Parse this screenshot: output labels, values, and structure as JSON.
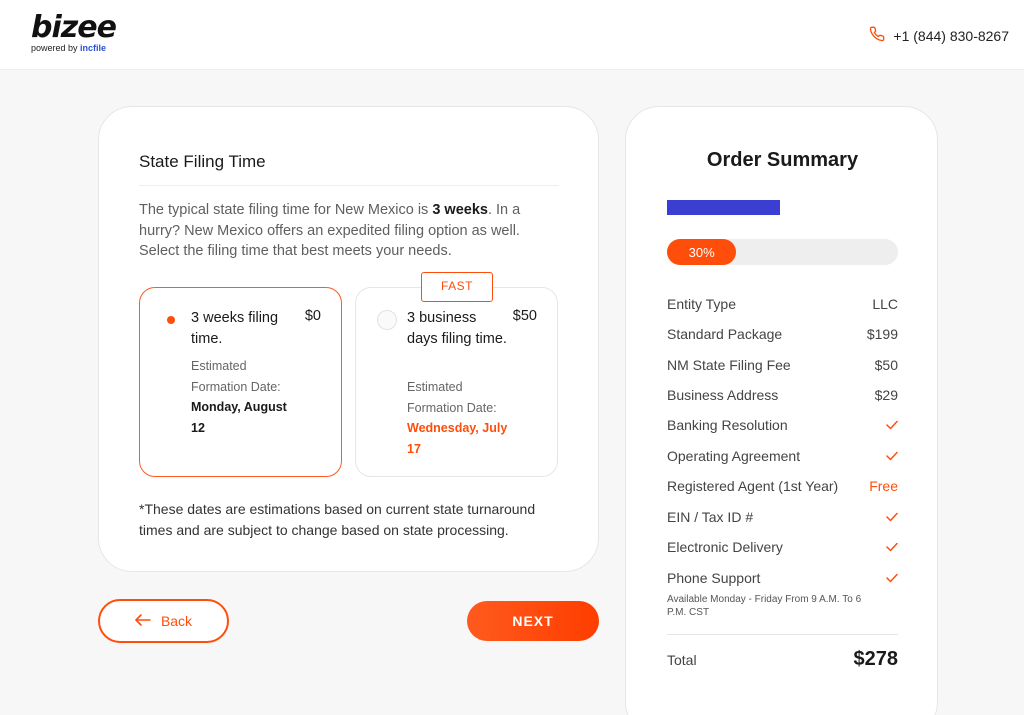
{
  "header": {
    "logo_word": "bizee",
    "logo_powered": "powered by ",
    "logo_inc": "incfile",
    "phone": "+1 (844) 830-8267",
    "phone_icon": "phone-icon"
  },
  "filing": {
    "title": "State Filing Time",
    "intro_before": "The typical state filing time for New Mexico is ",
    "intro_bold": "3 weeks",
    "intro_after": ". In a hurry? New Mexico offers an expedited filing option as well. Select the filing time that best meets your needs.",
    "options": [
      {
        "title": "3 weeks filing time.",
        "price": "$0",
        "est_label": "Estimated Formation Date:",
        "est_date": "Monday, August 12",
        "selected": true
      },
      {
        "title": "3 business days filing time.",
        "price": "$50",
        "est_label": "Estimated Formation Date:",
        "est_date": "Wednesday, July 17",
        "badge": "FAST",
        "selected": false
      }
    ],
    "footnote": "*These dates are estimations based on current state turnaround times and are subject to change based on state processing."
  },
  "nav": {
    "back_label": "Back",
    "next_label": "NEXT"
  },
  "summary": {
    "title": "Order Summary",
    "brand_color": "#3a3fd1",
    "progress": {
      "value": 0.3,
      "label": "30%"
    },
    "items": [
      {
        "label": "Entity Type",
        "value": "LLC"
      },
      {
        "label": "Standard Package",
        "value": "$199"
      },
      {
        "label": "NM State Filing Fee",
        "value": "$50"
      },
      {
        "label": "Business Address",
        "value": "$29"
      },
      {
        "label": "Banking Resolution",
        "icon": "check-icon"
      },
      {
        "label": "Operating Agreement",
        "icon": "check-icon"
      },
      {
        "label": "Registered Agent (1st Year)",
        "value": "Free"
      },
      {
        "label": "EIN / Tax ID #",
        "icon": "check-icon"
      },
      {
        "label": "Electronic Delivery",
        "icon": "check-icon"
      },
      {
        "label": "Phone Support",
        "icon": "check-icon"
      }
    ],
    "support_note": "Available Monday - Friday From 9 A.M. To 6 P.M. CST",
    "total_label": "Total",
    "total_value": "$278"
  },
  "colors": {
    "accent": "#ff4e0c",
    "brand_blue": "#3a3fd1"
  }
}
